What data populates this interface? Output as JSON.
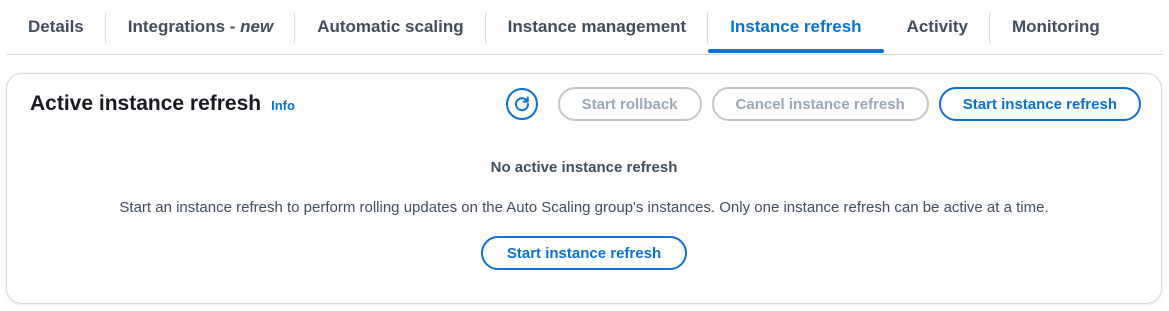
{
  "tabs": [
    {
      "label": "Details"
    },
    {
      "label": "Integrations - ",
      "suffix": "new"
    },
    {
      "label": "Automatic scaling"
    },
    {
      "label": "Instance management"
    },
    {
      "label": "Instance refresh"
    },
    {
      "label": "Activity"
    },
    {
      "label": "Monitoring"
    }
  ],
  "active_tab": "Instance refresh",
  "panel": {
    "title": "Active instance refresh",
    "info_label": "Info",
    "refresh_icon": "refresh-icon",
    "buttons": {
      "start_rollback": "Start rollback",
      "cancel_refresh": "Cancel instance refresh",
      "start_refresh": "Start instance refresh"
    },
    "empty_state": {
      "title": "No active instance refresh",
      "description": "Start an instance refresh to perform rolling updates on the Auto Scaling group's instances. Only one instance refresh can be active at a time.",
      "action_label": "Start instance refresh"
    }
  },
  "colors": {
    "accent": "#0972d3",
    "text": "#16191f",
    "muted_text": "#414d5c",
    "disabled": "#9ba7b6",
    "border": "#d5dbdb"
  }
}
